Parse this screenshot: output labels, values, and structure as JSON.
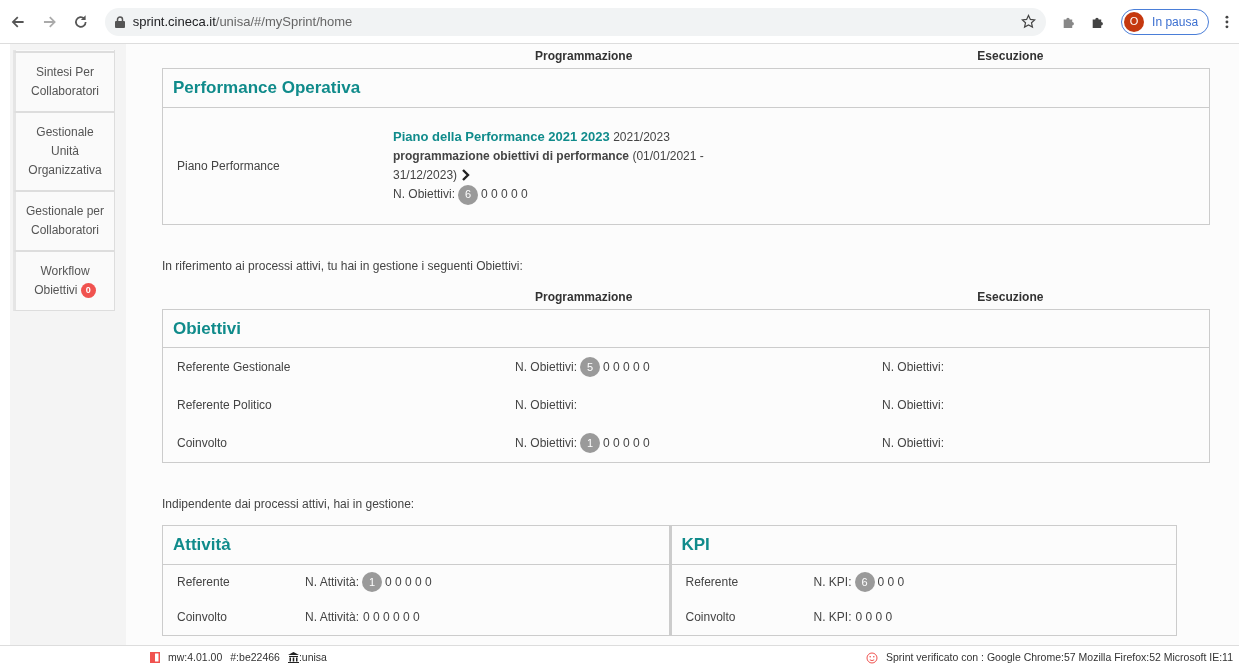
{
  "browser": {
    "url_host": "sprint.cineca.it",
    "url_path": "/unisa/#/mySprint/home",
    "profile_initial": "O",
    "profile_status": "In pausa"
  },
  "sidebar": {
    "items": [
      {
        "label": "Sintesi Per Collaboratori"
      },
      {
        "label": "Gestionale Unità Organizzativa"
      },
      {
        "label": "Gestionale per Collaboratori"
      },
      {
        "label": "Workflow Obiettivi",
        "badge": "0"
      }
    ]
  },
  "performance": {
    "columns": [
      "Programmazione",
      "Esecuzione"
    ],
    "title": "Performance Operativa",
    "row_label": "Piano Performance",
    "plan_title": "Piano della Performance 2021 2023",
    "plan_period": "2021/2023",
    "program": "**programmazione obiettivi di performance** (01/01/2021 -",
    "program_end": "31/12/2023)",
    "count": {
      "label": "N. Obiettivi:",
      "badge": "6",
      "rest": "0 0 0 0 0"
    }
  },
  "objectives_intro": "In riferimento ai processi attivi, tu hai in gestione i seguenti Obiettivi:",
  "objectives": {
    "columns": [
      "Programmazione",
      "Esecuzione"
    ],
    "title": "Obiettivi",
    "rows": [
      {
        "label": "Referente Gestionale",
        "programmazione": {
          "label": "N. Obiettivi:",
          "badge": "5",
          "rest": "0 0 0 0 0"
        },
        "esecuzione": {
          "label": "N. Obiettivi:"
        }
      },
      {
        "label": "Referente Politico",
        "programmazione": {
          "label": "N. Obiettivi:"
        },
        "esecuzione": {
          "label": "N. Obiettivi:"
        }
      },
      {
        "label": "Coinvolto",
        "programmazione": {
          "label": "N. Obiettivi:",
          "badge": "1",
          "rest": "0 0 0 0 0"
        },
        "esecuzione": {
          "label": "N. Obiettivi:"
        }
      }
    ]
  },
  "independent_intro": "Indipendente dai processi attivi, hai in gestione:",
  "panels": [
    {
      "title": "Attività",
      "rows": [
        {
          "label": "Referente",
          "count": {
            "label": "N. Attività:",
            "badge": "1",
            "rest": "0 0 0 0 0"
          }
        },
        {
          "label": "Coinvolto",
          "count": {
            "label": "N. Attività:",
            "rest": "0 0 0 0 0 0"
          }
        }
      ]
    },
    {
      "title": "KPI",
      "rows": [
        {
          "label": "Referente",
          "count": {
            "label": "N. KPI:",
            "badge": "6",
            "rest": "0 0 0"
          }
        },
        {
          "label": "Coinvolto",
          "count": {
            "label": "N. KPI:",
            "rest": "0 0 0 0"
          }
        }
      ]
    }
  ],
  "footer": {
    "version": "mw:4.01.00",
    "build": "#:be22466",
    "tenant": ":unisa",
    "compatibility": "Sprint verificato con : Google Chrome:57 Mozilla Firefox:52 Microsoft IE:11"
  }
}
